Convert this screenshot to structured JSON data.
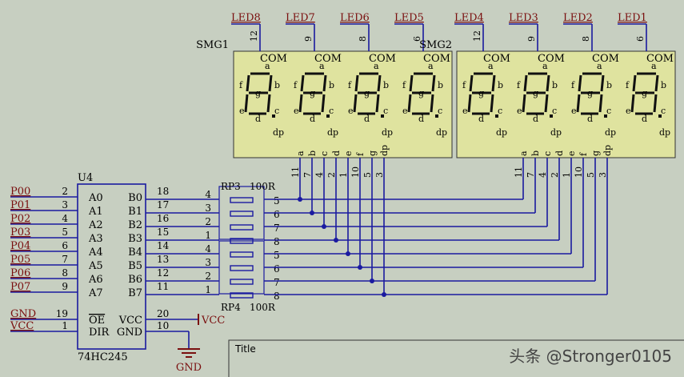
{
  "colors": {
    "background": "#c7cfc1",
    "wire": "#1a1aa0",
    "net_label": "#7a0f0f",
    "text": "#000000",
    "display_fill": "#dfe39f",
    "junction": "#1a1aa0"
  },
  "displays": [
    {
      "ref": "SMG1",
      "leds": [
        {
          "label": "LED8",
          "pin": "12"
        },
        {
          "label": "LED7",
          "pin": "9"
        },
        {
          "label": "LED6",
          "pin": "8"
        },
        {
          "label": "LED5",
          "pin": "6"
        }
      ],
      "bottom_pins": [
        "11",
        "7",
        "4",
        "2",
        "1",
        "10",
        "5",
        "3"
      ]
    },
    {
      "ref": "SMG2",
      "leds": [
        {
          "label": "LED4",
          "pin": "12"
        },
        {
          "label": "LED3",
          "pin": "9"
        },
        {
          "label": "LED2",
          "pin": "8"
        },
        {
          "label": "LED1",
          "pin": "6"
        }
      ],
      "bottom_pins": [
        "11",
        "7",
        "4",
        "2",
        "1",
        "10",
        "5",
        "3"
      ]
    }
  ],
  "digit_labels": {
    "com": "COM",
    "a": "a",
    "b": "b",
    "c": "c",
    "d": "d",
    "e": "e",
    "f": "f",
    "g": "g",
    "dp": "dp"
  },
  "segment_pin_names": [
    "a",
    "b",
    "c",
    "d",
    "e",
    "f",
    "g",
    "dp"
  ],
  "chip": {
    "ref": "U4",
    "part": "74HC245",
    "rows": [
      {
        "net": "P00",
        "pin_in": "2",
        "a": "A0",
        "b": "B0",
        "pin_out": "18"
      },
      {
        "net": "P01",
        "pin_in": "3",
        "a": "A1",
        "b": "B1",
        "pin_out": "17"
      },
      {
        "net": "P02",
        "pin_in": "4",
        "a": "A2",
        "b": "B2",
        "pin_out": "16"
      },
      {
        "net": "P03",
        "pin_in": "5",
        "a": "A3",
        "b": "B3",
        "pin_out": "15"
      },
      {
        "net": "P04",
        "pin_in": "6",
        "a": "A4",
        "b": "B4",
        "pin_out": "14"
      },
      {
        "net": "P05",
        "pin_in": "7",
        "a": "A5",
        "b": "B5",
        "pin_out": "13"
      },
      {
        "net": "P06",
        "pin_in": "8",
        "a": "A6",
        "b": "B6",
        "pin_out": "12"
      },
      {
        "net": "P07",
        "pin_in": "9",
        "a": "A7",
        "b": "B7",
        "pin_out": "11"
      }
    ],
    "ctrl": [
      {
        "net": "GND",
        "pin_in": "19",
        "left": "OE",
        "right": "VCC",
        "pin_out": "20",
        "right_net": "VCC"
      },
      {
        "net": "VCC",
        "pin_in": "1",
        "left": "DIR",
        "right": "GND",
        "pin_out": "10",
        "right_net": "GND"
      }
    ]
  },
  "resistors": [
    {
      "ref": "RP3",
      "value": "100R",
      "left_pins": [
        "4",
        "3",
        "2",
        "1"
      ],
      "right_pins": [
        "5",
        "6",
        "7",
        "8"
      ]
    },
    {
      "ref": "RP4",
      "value": "100R",
      "left_pins": [
        "4",
        "3",
        "2",
        "1"
      ],
      "right_pins": [
        "5",
        "6",
        "7",
        "8"
      ]
    }
  ],
  "title_block": {
    "label": "Title"
  },
  "watermark": "头条 @Stronger0105"
}
